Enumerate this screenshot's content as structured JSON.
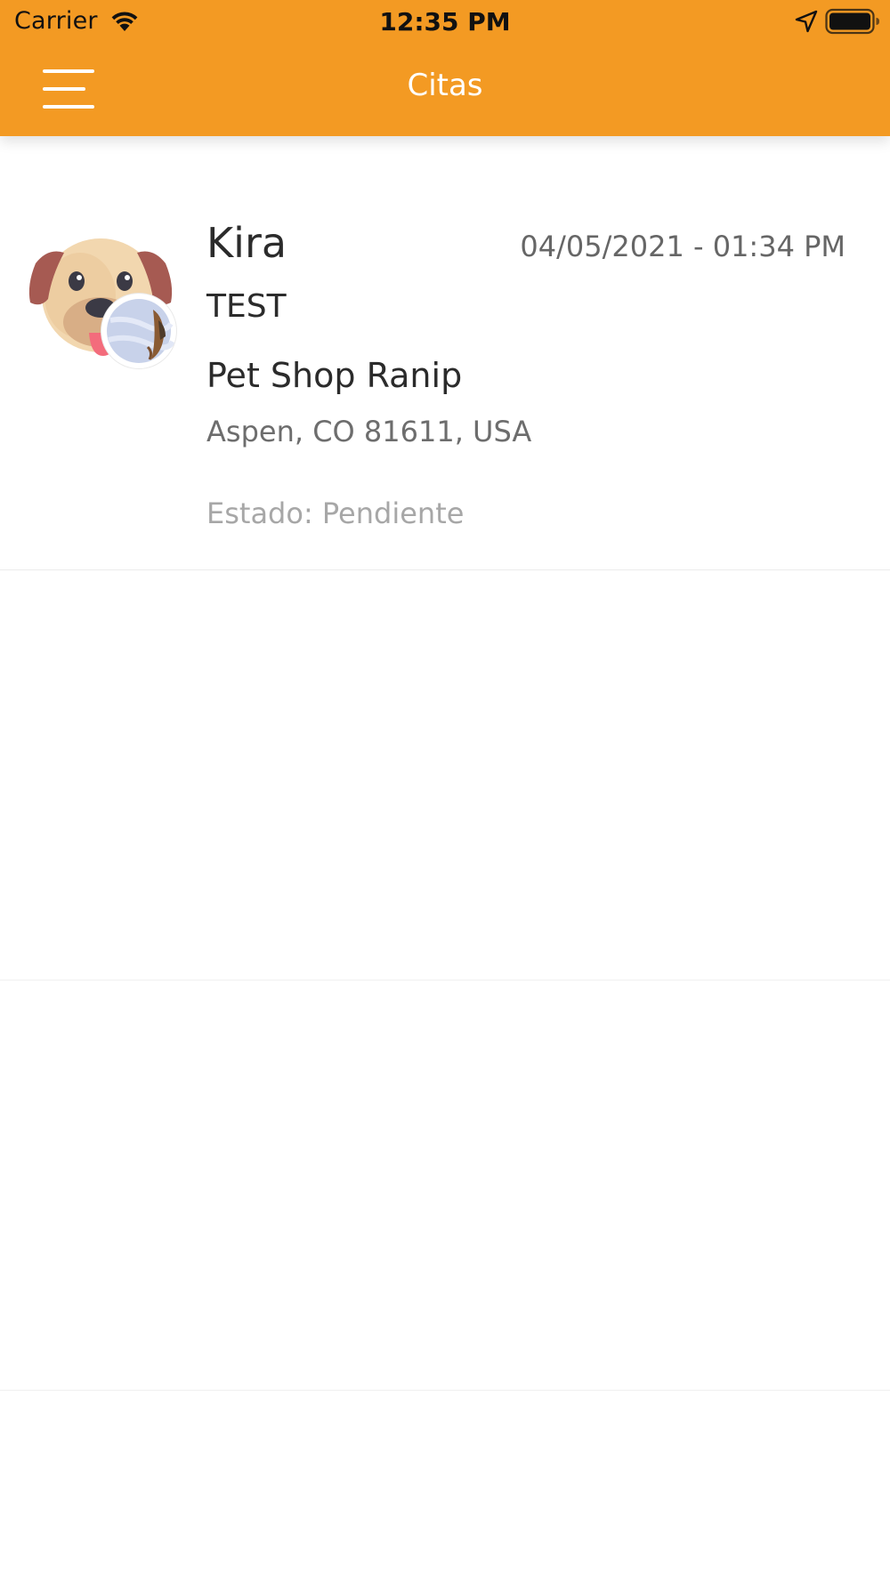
{
  "status_bar": {
    "carrier": "Carrier",
    "time": "12:35 PM",
    "icons": [
      "wifi-icon",
      "location-arrow-icon",
      "battery-icon"
    ]
  },
  "header": {
    "title": "Citas",
    "menu_icon": "hamburger-menu-icon",
    "background_color": "#F39A23"
  },
  "appointments": [
    {
      "pet_name": "Kira",
      "datetime": "04/05/2021 - 01:34 PM",
      "note": "TEST",
      "shop_name": "Pet Shop Ranip",
      "shop_address": "Aspen, CO 81611, USA",
      "status": "Estado: Pendiente",
      "pet_avatar": "dog-face-icon",
      "shop_avatar": "shop-photo"
    }
  ]
}
